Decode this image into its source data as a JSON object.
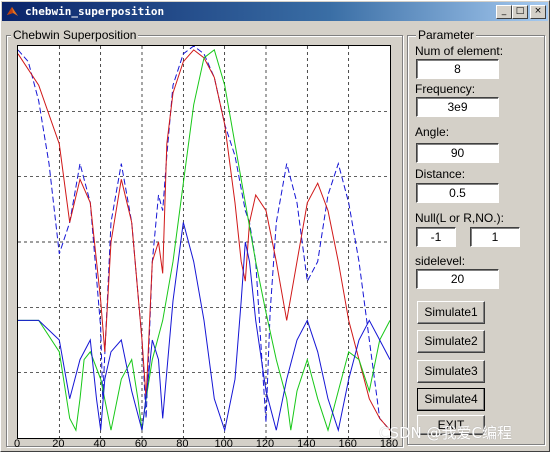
{
  "window": {
    "title": "chebwin_superposition",
    "min_glyph": "_",
    "max_glyph": "□",
    "close_glyph": "×"
  },
  "plot_panel": {
    "title": "Chebwin Superposition"
  },
  "parameter_panel": {
    "title": "Parameter",
    "num_elements_label": "Num of element:",
    "num_elements_value": "8",
    "frequency_label": "Frequency:",
    "frequency_value": "3e9",
    "angle_label": "Angle:",
    "angle_value": "90",
    "distance_label": "Distance:",
    "distance_value": "0.5",
    "null_label": "Null(L or R,NO.):",
    "null_side_value": "-1",
    "null_number_value": "1",
    "sidelevel_label": "sidelevel:",
    "sidelevel_value": "20"
  },
  "buttons": {
    "simulate1": "Simulate1",
    "simulate2": "Simulate2",
    "simulate3": "Simulate3",
    "simulate4": "Simulate4",
    "exit": "EXIT"
  },
  "watermark": "CSDN @我爱C编程",
  "colors": {
    "titlebar_start": "#0a246a",
    "face": "#d4d0c8",
    "series_blue_dashed": "#1010d0",
    "series_red": "#cc1010",
    "series_green": "#10c010",
    "series_blue": "#1010b0"
  },
  "chart_data": {
    "type": "line",
    "title": "",
    "xlabel": "",
    "ylabel": "",
    "xlim": [
      0,
      180
    ],
    "ylim": [
      0,
      1
    ],
    "grid": true,
    "x_ticks": [
      "0",
      "20",
      "40",
      "60",
      "80",
      "100",
      "120",
      "140",
      "160",
      "180"
    ],
    "series": [
      {
        "style": "dashed",
        "color": "blue",
        "x": [
          0,
          5,
          10,
          15,
          20,
          25,
          30,
          35,
          40,
          41,
          45,
          50,
          55,
          60,
          62,
          65,
          68,
          70,
          72,
          75,
          80,
          85,
          90,
          95,
          100,
          105,
          110,
          112,
          115,
          118,
          120,
          122,
          125,
          130,
          135,
          140,
          145,
          150,
          155,
          160,
          165,
          170,
          175,
          180
        ],
        "y": [
          0.99,
          0.96,
          0.86,
          0.7,
          0.47,
          0.55,
          0.7,
          0.6,
          0.28,
          0.1,
          0.55,
          0.7,
          0.55,
          0.25,
          0.05,
          0.45,
          0.62,
          0.58,
          0.72,
          0.9,
          0.98,
          1.0,
          0.98,
          0.92,
          0.8,
          0.72,
          0.58,
          0.55,
          0.45,
          0.2,
          0.04,
          0.32,
          0.55,
          0.7,
          0.6,
          0.4,
          0.45,
          0.62,
          0.7,
          0.6,
          0.45,
          0.25,
          0.05,
          0.02
        ]
      },
      {
        "style": "solid",
        "color": "red",
        "x": [
          0,
          10,
          20,
          25,
          30,
          35,
          40,
          42,
          45,
          50,
          55,
          60,
          62,
          65,
          68,
          70,
          72,
          75,
          80,
          85,
          90,
          95,
          100,
          105,
          108,
          110,
          112,
          115,
          120,
          125,
          130,
          135,
          140,
          145,
          150,
          155,
          160,
          165,
          170,
          175,
          180
        ],
        "y": [
          0.98,
          0.9,
          0.75,
          0.55,
          0.66,
          0.6,
          0.35,
          0.22,
          0.5,
          0.66,
          0.55,
          0.25,
          0.1,
          0.45,
          0.5,
          0.42,
          0.75,
          0.88,
          0.96,
          0.99,
          0.97,
          0.92,
          0.8,
          0.6,
          0.45,
          0.4,
          0.55,
          0.62,
          0.58,
          0.45,
          0.3,
          0.45,
          0.6,
          0.65,
          0.58,
          0.45,
          0.3,
          0.2,
          0.1,
          0.05,
          0.02
        ]
      },
      {
        "style": "solid",
        "color": "green",
        "x": [
          0,
          10,
          20,
          25,
          28,
          30,
          32,
          35,
          40,
          45,
          50,
          55,
          58,
          60,
          62,
          65,
          70,
          75,
          80,
          85,
          90,
          95,
          100,
          105,
          110,
          115,
          120,
          125,
          130,
          132,
          135,
          140,
          145,
          150,
          155,
          160,
          165,
          170,
          175,
          180
        ],
        "y": [
          0.3,
          0.3,
          0.22,
          0.05,
          0.02,
          0.1,
          0.2,
          0.22,
          0.15,
          0.02,
          0.15,
          0.2,
          0.1,
          0.02,
          0.1,
          0.2,
          0.3,
          0.45,
          0.65,
          0.85,
          0.97,
          0.99,
          0.9,
          0.75,
          0.6,
          0.45,
          0.32,
          0.2,
          0.1,
          0.02,
          0.12,
          0.2,
          0.1,
          0.02,
          0.12,
          0.22,
          0.2,
          0.12,
          0.25,
          0.3
        ]
      },
      {
        "style": "solid",
        "color": "blue",
        "x": [
          0,
          10,
          20,
          25,
          30,
          35,
          38,
          40,
          42,
          45,
          50,
          55,
          60,
          63,
          65,
          68,
          70,
          75,
          80,
          85,
          90,
          95,
          100,
          105,
          108,
          110,
          112,
          115,
          120,
          125,
          130,
          135,
          140,
          145,
          150,
          155,
          160,
          165,
          170,
          175,
          180
        ],
        "y": [
          0.3,
          0.3,
          0.25,
          0.1,
          0.2,
          0.25,
          0.1,
          0.02,
          0.15,
          0.22,
          0.25,
          0.12,
          0.02,
          0.15,
          0.25,
          0.2,
          0.05,
          0.35,
          0.55,
          0.45,
          0.3,
          0.1,
          0.02,
          0.15,
          0.35,
          0.5,
          0.45,
          0.3,
          0.12,
          0.02,
          0.15,
          0.25,
          0.3,
          0.22,
          0.1,
          0.02,
          0.15,
          0.25,
          0.3,
          0.25,
          0.2
        ]
      }
    ]
  }
}
